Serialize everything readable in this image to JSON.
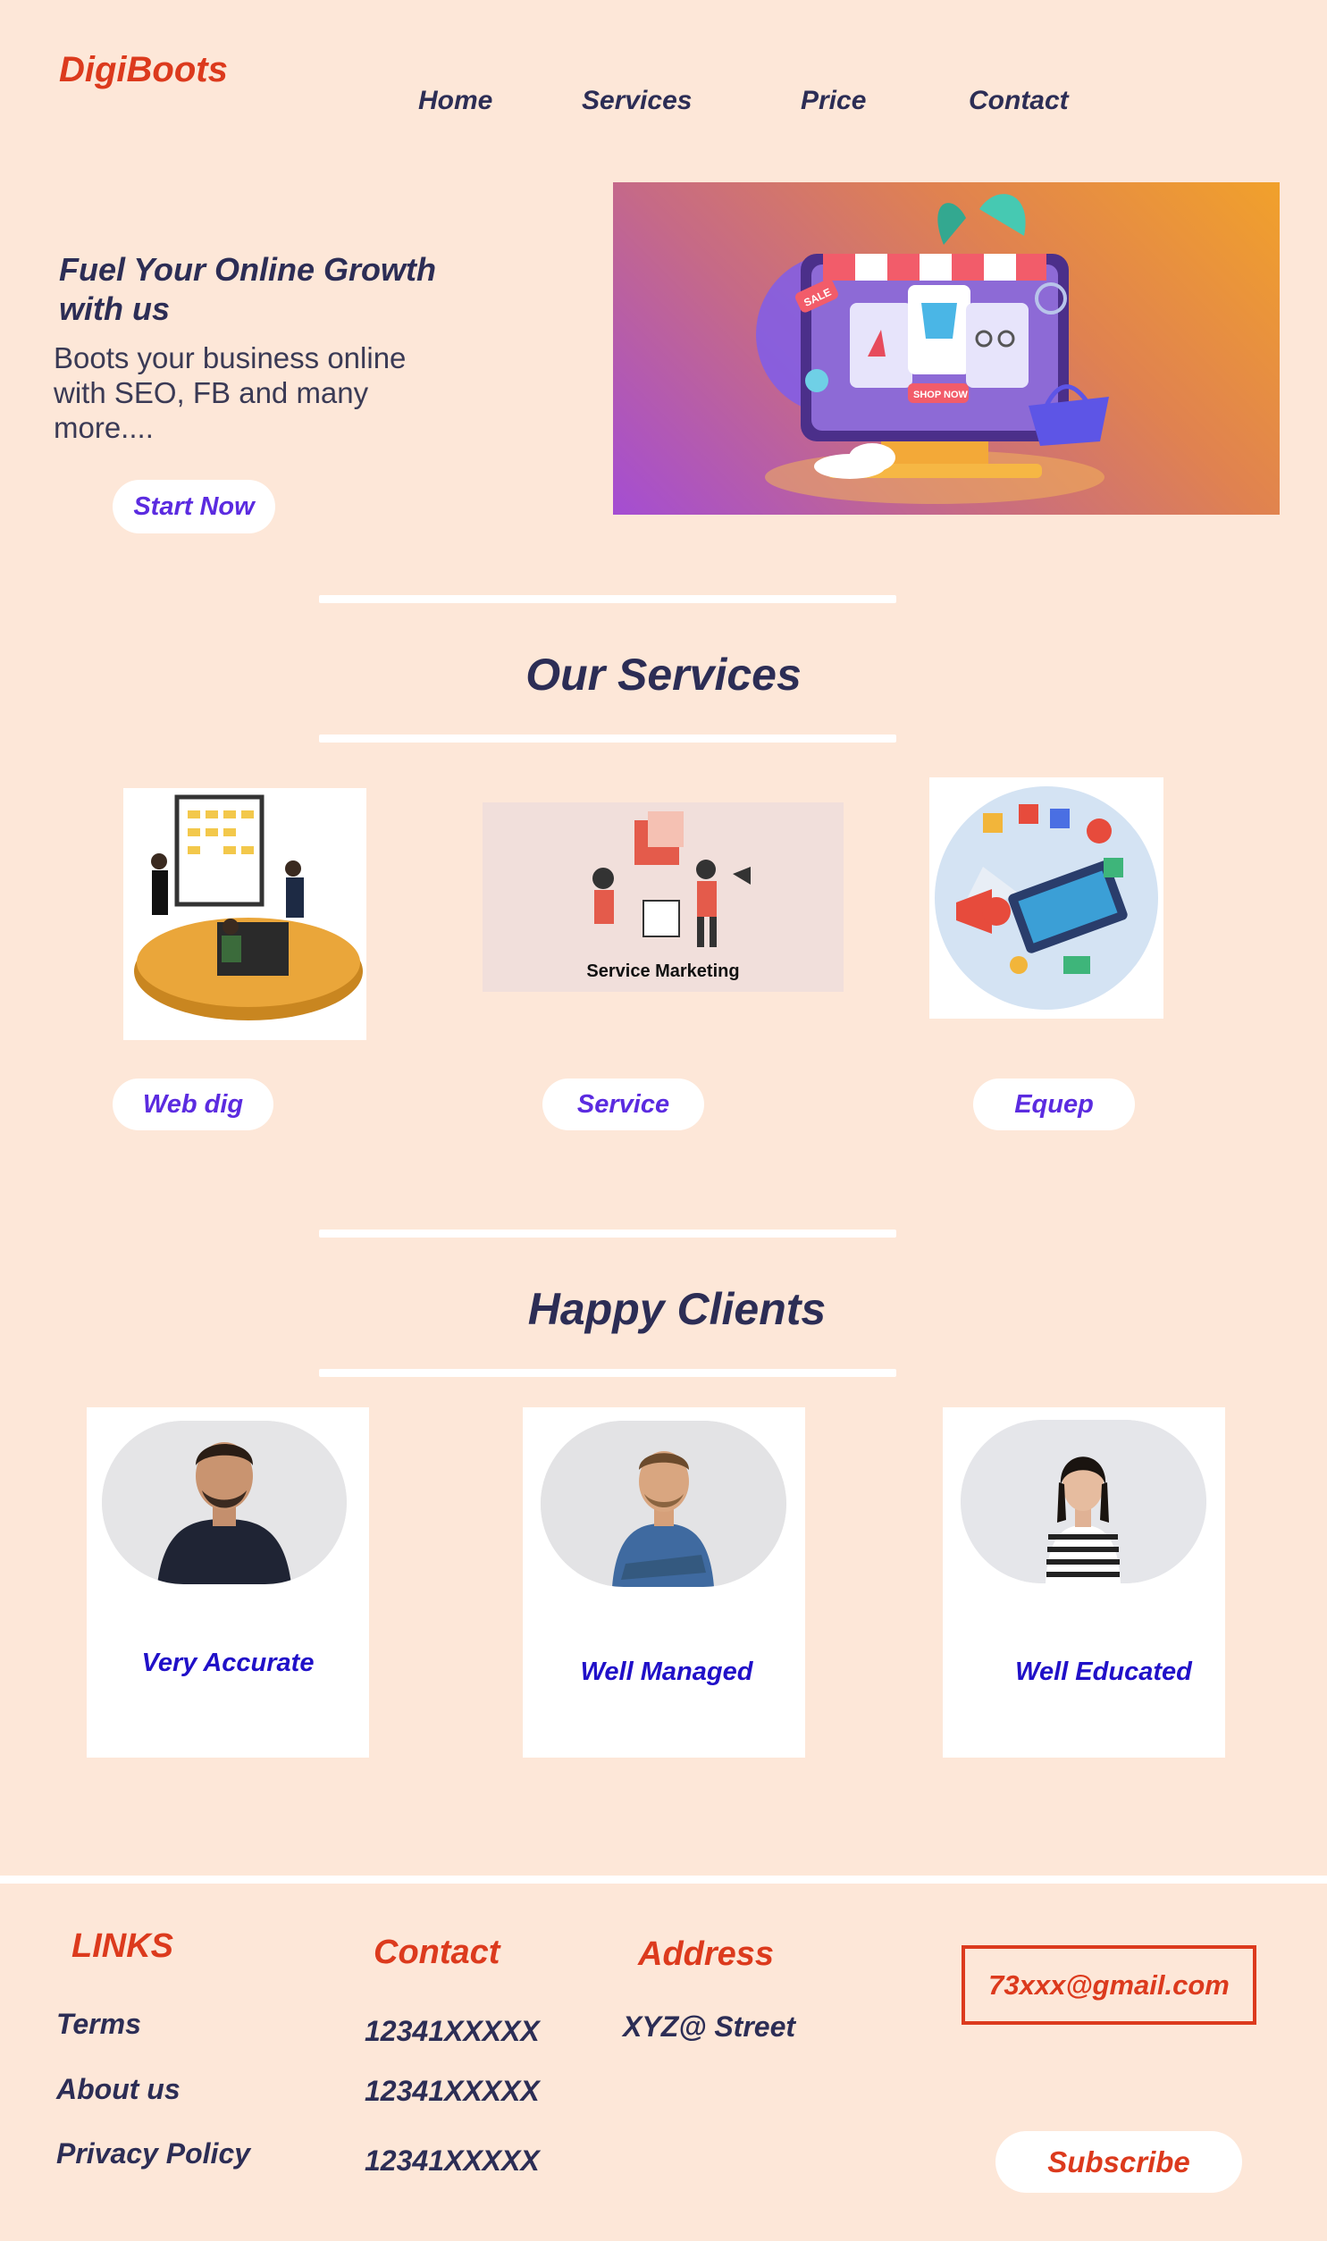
{
  "brand": "DigiBoots",
  "nav": [
    "Home",
    "Services",
    "Price",
    "Contact"
  ],
  "hero": {
    "title": "Fuel Your Online Growth with us",
    "subtitle": "Boots your business online\nwith SEO, FB and many\n more....",
    "cta": "Start Now",
    "image": {
      "sale_tag": "SALE",
      "shop_button": "SHOP NOW"
    }
  },
  "services": {
    "title": "Our Services",
    "image_caption": "Service Marketing",
    "buttons": [
      "Web dig",
      "Service",
      "Equep"
    ]
  },
  "clients": {
    "title": "Happy Clients",
    "labels": [
      "Very Accurate",
      "Well Managed",
      "Well Educated"
    ]
  },
  "footer": {
    "links_heading": "LINKS",
    "links": [
      "Terms",
      "About us",
      "Privacy Policy"
    ],
    "contact_heading": "Contact",
    "phones": [
      "12341XXXXX",
      "12341XXXXX",
      "12341XXXXX"
    ],
    "address_heading": "Address",
    "address": "XYZ@ Street",
    "email": "73xxx@gmail.com",
    "subscribe": "Subscribe"
  },
  "colors": {
    "background": "#fde7d8",
    "brand": "#dc3a1d",
    "heading": "#2c2d55",
    "accent_purple": "#5b2be0",
    "label_blue": "#2010c8"
  }
}
